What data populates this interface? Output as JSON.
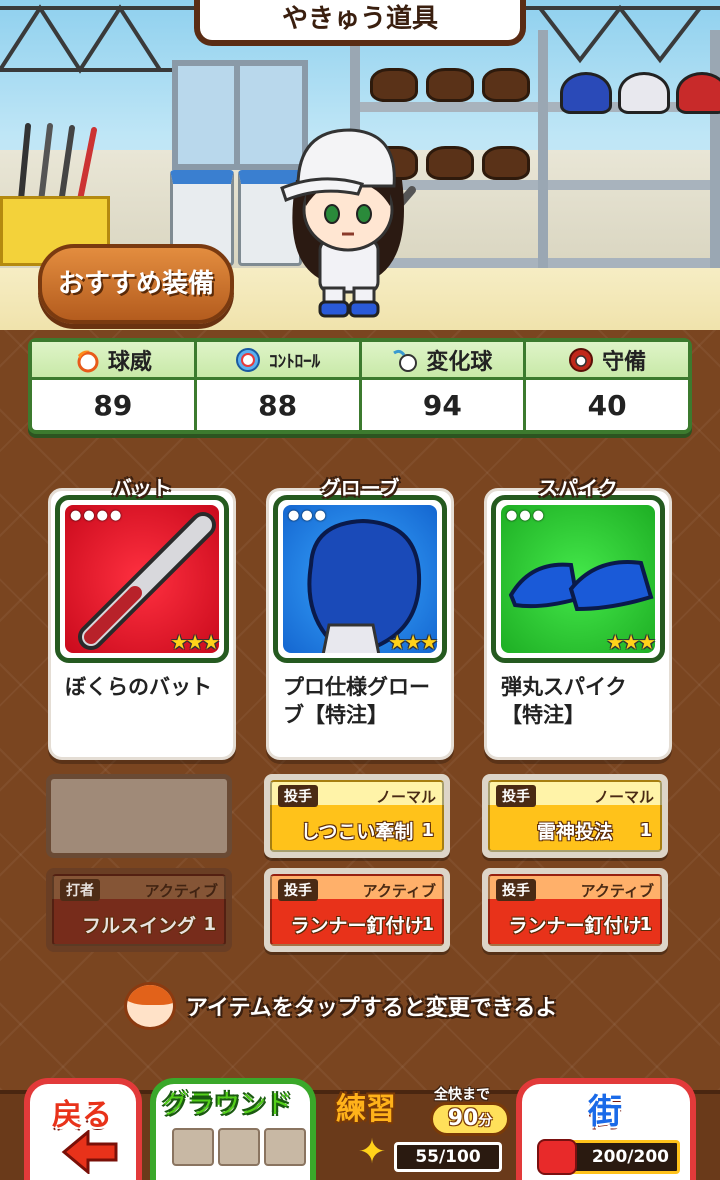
{
  "header": {
    "title": "やきゅう道具"
  },
  "recommend_button": {
    "label": "おすすめ装備"
  },
  "stats": [
    {
      "label": "球威",
      "value": "89",
      "icon": "fireball-icon",
      "small": false
    },
    {
      "label": "ｺﾝﾄﾛｰﾙ",
      "value": "88",
      "icon": "target-ball-icon",
      "small": true
    },
    {
      "label": "変化球",
      "value": "94",
      "icon": "curve-ball-icon",
      "small": false
    },
    {
      "label": "守備",
      "value": "40",
      "icon": "glove-icon",
      "small": false
    }
  ],
  "slots": [
    {
      "category": "バット",
      "name": "ぼくらのバット",
      "dots": "●●●●",
      "stars": "★★★",
      "color": "red"
    },
    {
      "category": "グローブ",
      "name": "プロ仕様グローブ【特注】",
      "dots": "●●●",
      "stars": "★★★",
      "color": "blue"
    },
    {
      "category": "スパイク",
      "name": "弾丸スパイク【特注】",
      "dots": "●●●",
      "stars": "★★★",
      "color": "green"
    }
  ],
  "skills": {
    "bat_active": {
      "role": "打者",
      "kind": "アクティブ",
      "name": "フルスイング",
      "level": "1"
    },
    "glove_normal": {
      "role": "投手",
      "kind": "ノーマル",
      "name": "しつこい牽制",
      "level": "1"
    },
    "glove_active": {
      "role": "投手",
      "kind": "アクティブ",
      "name": "ランナー釘付け",
      "level": "1"
    },
    "spike_normal": {
      "role": "投手",
      "kind": "ノーマル",
      "name": "雷神投法",
      "level": "1"
    },
    "spike_active": {
      "role": "投手",
      "kind": "アクティブ",
      "name": "ランナー釘付け",
      "level": "1"
    }
  },
  "hint": {
    "text": "アイテムをタップすると変更できるよ"
  },
  "nav": {
    "back": {
      "label": "戻る"
    },
    "ground": {
      "label": "グラウンド"
    },
    "practice": {
      "label": "練習",
      "note": "全快まで",
      "time": "90",
      "time_unit": "分",
      "stamina": "55/100"
    },
    "town": {
      "label": "街",
      "energy": "200/200"
    }
  }
}
